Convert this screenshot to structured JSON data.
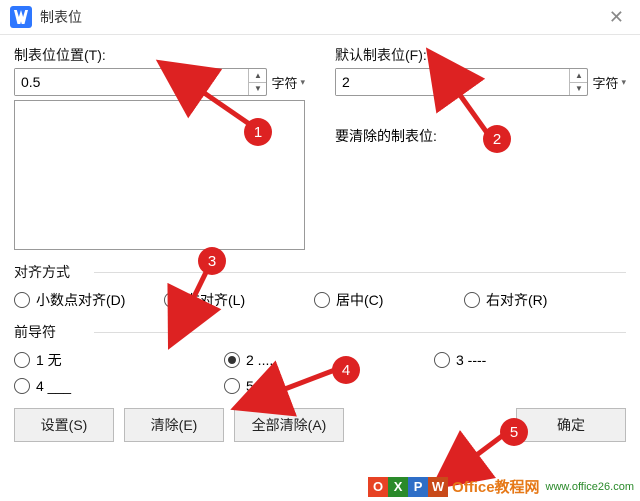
{
  "title": "制表位",
  "tabstop": {
    "label": "制表位位置(T):",
    "value": "0.5",
    "unit": "字符"
  },
  "default_tab": {
    "label": "默认制表位(F):",
    "value": "2",
    "unit": "字符"
  },
  "clear_label": "要清除的制表位:",
  "align": {
    "group_label": "对齐方式",
    "options": {
      "decimal": "小数点对齐(D)",
      "left": "左对齐(L)",
      "center": "居中(C)",
      "right": "右对齐(R)"
    },
    "selected": "left"
  },
  "leader": {
    "group_label": "前导符",
    "options": {
      "none": "1 无",
      "dots": "2 .....",
      "dashes": "3 ----",
      "underline": "4 ___",
      "mdots": "5 ……"
    },
    "selected": "dots"
  },
  "buttons": {
    "set": "设置(S)",
    "clear": "清除(E)",
    "clear_all": "全部清除(A)",
    "ok": "确定"
  },
  "badges": {
    "b1": "1",
    "b2": "2",
    "b3": "3",
    "b4": "4",
    "b5": "5"
  },
  "watermark": {
    "title": "Office教程网",
    "url": "www.office26.com"
  }
}
